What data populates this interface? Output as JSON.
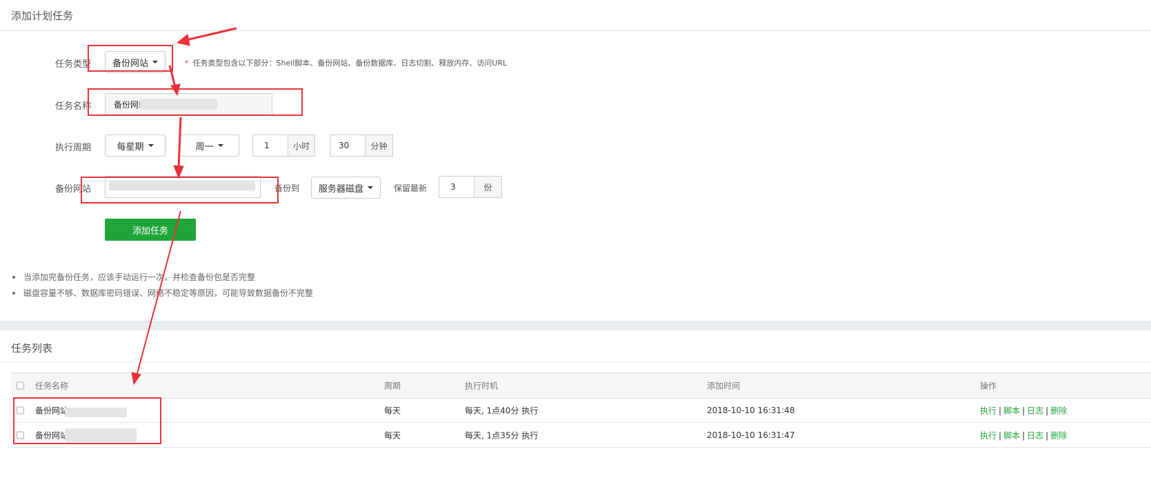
{
  "form_panel": {
    "title": "添加计划任务",
    "task_type": {
      "label": "任务类型",
      "value": "备份网站",
      "hint": "任务类型包含以下部分：Shell脚本、备份网站、备份数据库、日志切割、释放内存、访问URL"
    },
    "task_name": {
      "label": "任务名称",
      "value": "备份网站"
    },
    "cycle": {
      "label": "执行周期",
      "period": "每星期",
      "weekday": "周一",
      "hour": "1",
      "hour_unit": "小时",
      "minute": "30",
      "minute_unit": "分钟"
    },
    "backup_site": {
      "label": "备份网站",
      "backup_to_label": "备份到",
      "backup_to": "服务器磁盘",
      "keep_label": "保留最新",
      "keep_value": "3",
      "keep_unit": "份"
    },
    "submit_label": "添加任务",
    "tips": [
      "当添加完备份任务，应该手动运行一次，并检查备份包是否完整",
      "磁盘容量不够、数据库密码错误、网络不稳定等原因，可能导致数据备份不完整"
    ]
  },
  "list_panel": {
    "title": "任务列表",
    "columns": [
      "任务名称",
      "周期",
      "执行时机",
      "添加时间",
      "操作"
    ],
    "rows": [
      {
        "name": "备份网站",
        "cycle": "每天",
        "timing": "每天, 1点40分 执行",
        "added": "2018-10-10 16:31:48"
      },
      {
        "name": "备份网站",
        "cycle": "每天",
        "timing": "每天, 1点35分 执行",
        "added": "2018-10-10 16:31:47"
      }
    ],
    "ops": {
      "run": "执行",
      "script": "脚本",
      "log": "日志",
      "delete": "删除",
      "separator": "|"
    }
  },
  "colors": {
    "accent_green": "#20a53a",
    "annotation_red": "#e8313a",
    "required_star": "#e4393c"
  }
}
